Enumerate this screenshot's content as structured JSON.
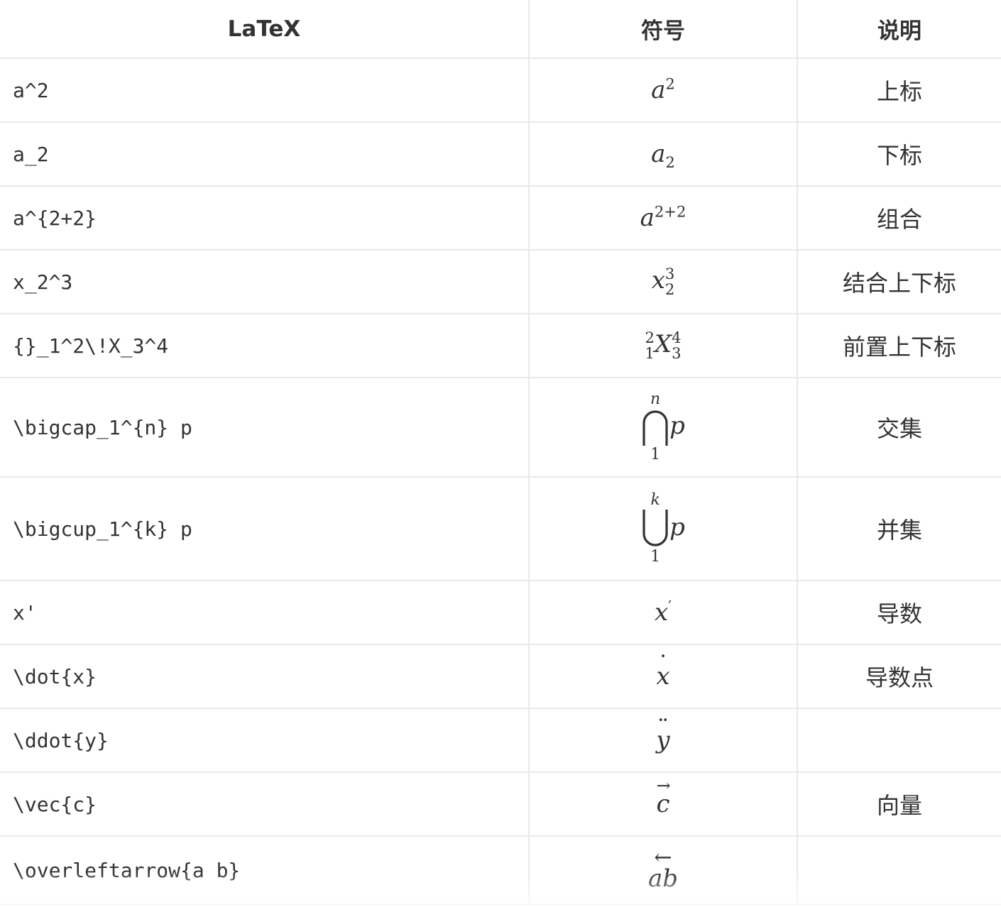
{
  "headers": [
    "LaTeX",
    "符号",
    "说明"
  ],
  "rows": [
    {
      "latex": "a^2",
      "desc": "上标"
    },
    {
      "latex": "a_2",
      "desc": "下标"
    },
    {
      "latex": "a^{2+2}",
      "desc": "组合"
    },
    {
      "latex": "x_2^3",
      "desc": "结合上下标"
    },
    {
      "latex": "{}_1^2\\!X_3^4",
      "desc": "前置上下标"
    },
    {
      "latex": "\\bigcap_1^{n} p",
      "desc": "交集"
    },
    {
      "latex": "\\bigcup_1^{k} p",
      "desc": "并集"
    },
    {
      "latex": "x'",
      "desc": "导数"
    },
    {
      "latex": "\\dot{x}",
      "desc": "导数点"
    },
    {
      "latex": "\\ddot{y}",
      "desc": ""
    },
    {
      "latex": "\\vec{c}",
      "desc": "向量"
    },
    {
      "latex": "\\overleftarrow{a b}",
      "desc": ""
    }
  ],
  "symbols": {
    "r0": {
      "base": "a",
      "sup": "2"
    },
    "r1": {
      "base": "a",
      "sub": "2"
    },
    "r2": {
      "base": "a",
      "sup": "2+2"
    },
    "r3": {
      "base": "x",
      "sup": "3",
      "sub": "2"
    },
    "r4": {
      "pre_sup": "2",
      "pre_sub": "1",
      "base": "X",
      "sup": "4",
      "sub": "3"
    },
    "r5": {
      "op": "⋂",
      "upper": "n",
      "lower": "1",
      "arg": "p"
    },
    "r6": {
      "op": "⋃",
      "upper": "k",
      "lower": "1",
      "arg": "p"
    },
    "r7": {
      "base": "x",
      "prime": "′"
    },
    "r8": {
      "base": "x",
      "accent": "˙"
    },
    "r9": {
      "base": "y",
      "accent": "¨"
    },
    "r10": {
      "base": "c",
      "accent": "→"
    },
    "r11": {
      "base": "ab",
      "accent": "←"
    }
  }
}
